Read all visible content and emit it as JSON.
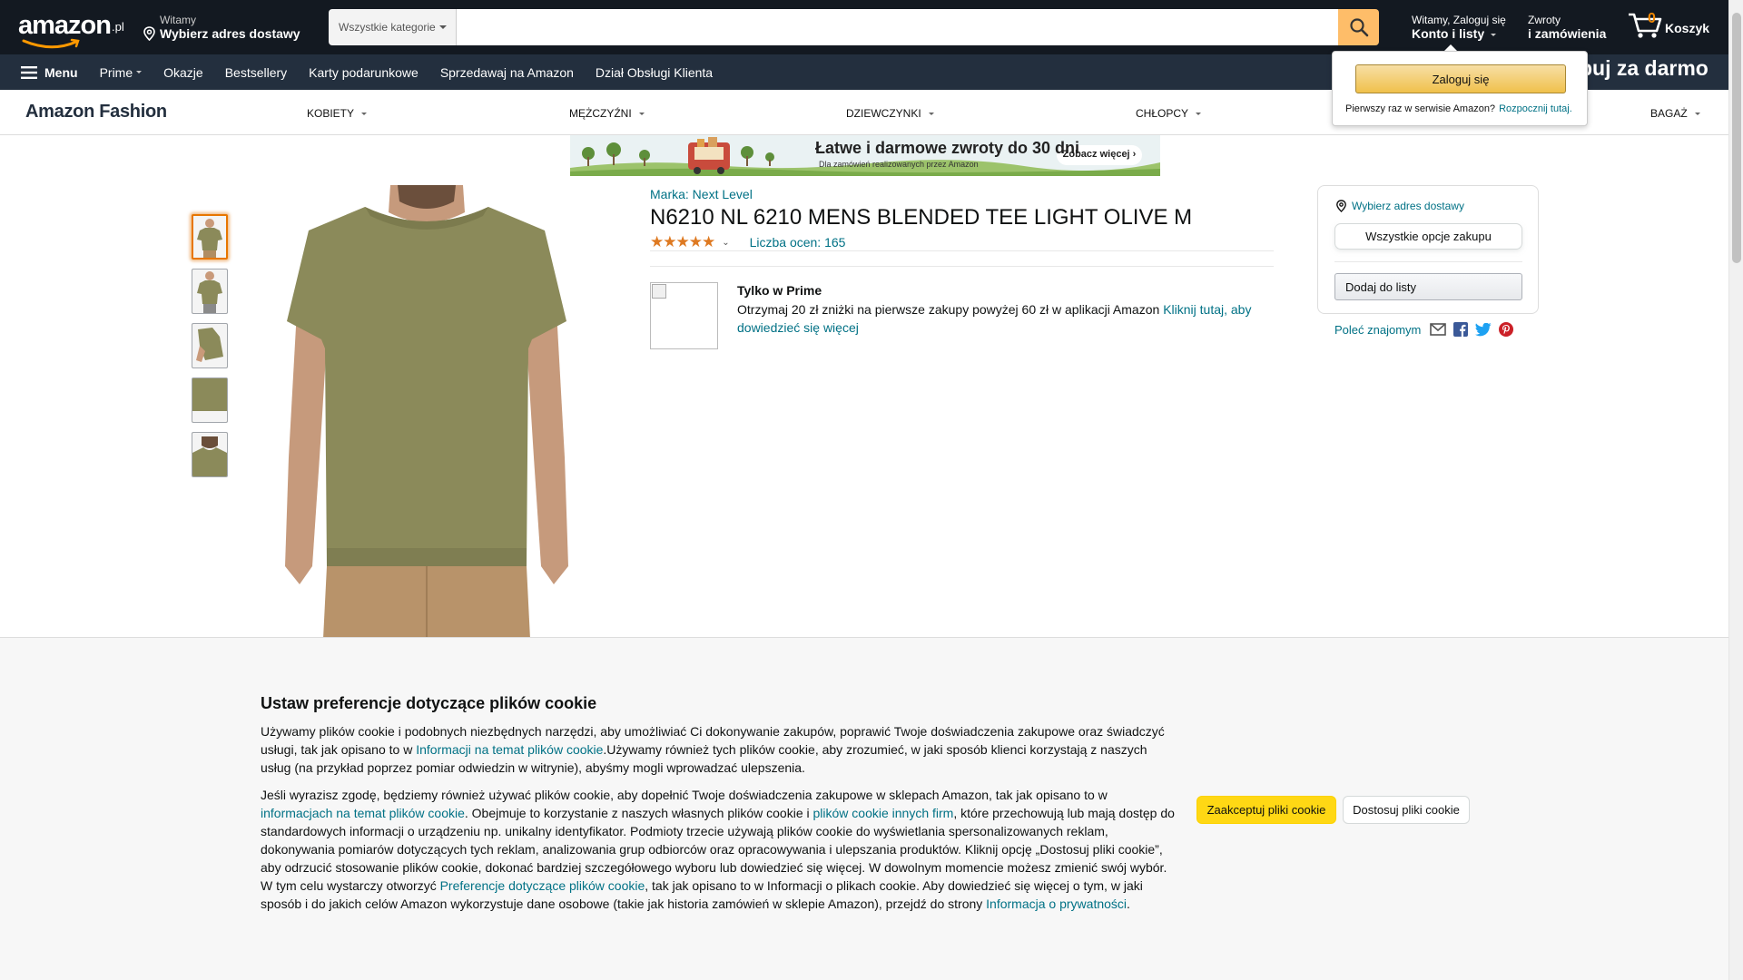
{
  "header": {
    "logo_suffix": ".pl",
    "deliver_line1": "Witamy",
    "deliver_line2": "Wybierz adres dostawy",
    "search_category": "Wszystkie kategorie",
    "search_placeholder": "",
    "account_line1": "Witamy, Zaloguj się",
    "account_line2": "Konto i listy",
    "returns_line1": "Zwroty",
    "returns_line2": "i zamówienia",
    "cart_count": "0",
    "cart_label": "Koszyk"
  },
  "subnav": {
    "menu": "Menu",
    "items": [
      "Prime",
      "Okazje",
      "Bestsellery",
      "Karty podarunkowe",
      "Sprzedawaj na Amazon",
      "Dział Obsługi Klienta"
    ],
    "promo": "buj za darmo"
  },
  "fashion": {
    "title": "Amazon Fashion",
    "categories": [
      "KOBIETY",
      "MĘŻCZYŹNI",
      "DZIEWCZYNKI",
      "CHŁOPCY",
      "BAGAŻ"
    ]
  },
  "banner": {
    "headline": "Łatwe i darmowe zwroty do 30 dni",
    "subline": "Dla zamówień realizowanych przez Amazon",
    "cta": "Zobacz więcej ›"
  },
  "flyout": {
    "signin": "Zaloguj się",
    "new_customer": "Pierwszy raz w serwisie Amazon?",
    "start_link": "Rozpocznij tutaj."
  },
  "product": {
    "brand": "Marka: Next Level",
    "title": "N6210 NL 6210 MENS BLENDED TEE LIGHT OLIVE M",
    "stars": "★★★★★",
    "rating": 4.5,
    "ratings_count": "Liczba ocen: 165",
    "prime_title": "Tylko w Prime",
    "prime_text": "Otrzymaj 20 zł zniżki na pierwsze zakupy powyżej 60 zł w aplikacji Amazon",
    "prime_link": "Kliknij tutaj, aby dowiedzieć się więcej",
    "shirt_color": "#8b8a5a"
  },
  "buybox": {
    "address": "Wybierz adres dostawy",
    "all_options": "Wszystkie opcje zakupu",
    "add_to_list": "Dodaj do listy",
    "share": "Poleć znajomym"
  },
  "cookie": {
    "title": "Ustaw preferencje dotyczące plików cookie",
    "p1_a": "Używamy plików cookie i podobnych niezbędnych narzędzi, aby umożliwiać Ci dokonywanie zakupów, poprawić Twoje doświadczenia zakupowe oraz świadczyć usługi, tak jak opisano to w ",
    "p1_link": "Informacji na temat plików cookie",
    "p1_b": ".Używamy również tych plików cookie, aby zrozumieć, w jaki sposób klienci korzystają z naszych usług (na przykład poprzez pomiar odwiedzin w witrynie), abyśmy mogli wprowadzać ulepszenia.",
    "p2_a": "Jeśli wyrazisz zgodę, będziemy również używać plików cookie, aby dopełnić Twoje doświadczenia zakupowe w sklepach Amazon, tak jak opisano to w ",
    "p2_link1": "informacjach na temat plików cookie",
    "p2_b": ". Obejmuje to korzystanie z naszych własnych plików cookie i ",
    "p2_link2": "plików cookie innych firm",
    "p2_c": ", które przechowują lub mają dostęp do standardowych informacji o urządzeniu np. unikalny identyfikator. Podmioty trzecie używają plików cookie do wyświetlania spersonalizowanych reklam, dokonywania pomiarów dotyczących tych reklam, analizowania grup odbiorców oraz opracowywania i ulepszania produktów. Kliknij opcję „Dostosuj pliki cookie”, aby odrzucić stosowanie plików cookie, dokonać bardziej szczegółowego wyboru lub dowiedzieć się więcej. W dowolnym momencie możesz zmienić swój wybór. W tym celu wystarczy otworzyć ",
    "p2_link3": "Preferencje dotyczące plików cookie",
    "p2_d": ", tak jak opisano to w Informacji o plikach cookie. Aby dowiedzieć się więcej o tym, w jaki sposób i do jakich celów Amazon wykorzystuje dane osobowe (takie jak historia zamówień w sklepie Amazon), przejdź do strony ",
    "p2_link4": "Informacja o prywatności",
    "p2_e": ".",
    "accept": "Zaakceptuj pliki cookie",
    "customize": "Dostosuj pliki cookie"
  }
}
